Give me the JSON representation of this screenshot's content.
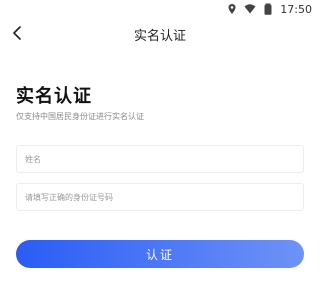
{
  "status_bar": {
    "time": "17:50",
    "icons": [
      "location-icon",
      "wifi-icon",
      "battery-icon"
    ]
  },
  "nav": {
    "back_icon": "chevron-left-icon",
    "title": "实名认证"
  },
  "main": {
    "heading": "实名认证",
    "subtitle": "仅支持中国居民身份证进行实名认证",
    "name_field": {
      "value": "",
      "placeholder": "姓名"
    },
    "id_field": {
      "value": "",
      "placeholder": "请填写正确的身份证号码"
    },
    "submit_label": "认证"
  },
  "colors": {
    "accent_start": "#2a5cf5",
    "accent_end": "#6e93f6",
    "text_primary": "#111111",
    "text_secondary": "#8a8a8a"
  }
}
